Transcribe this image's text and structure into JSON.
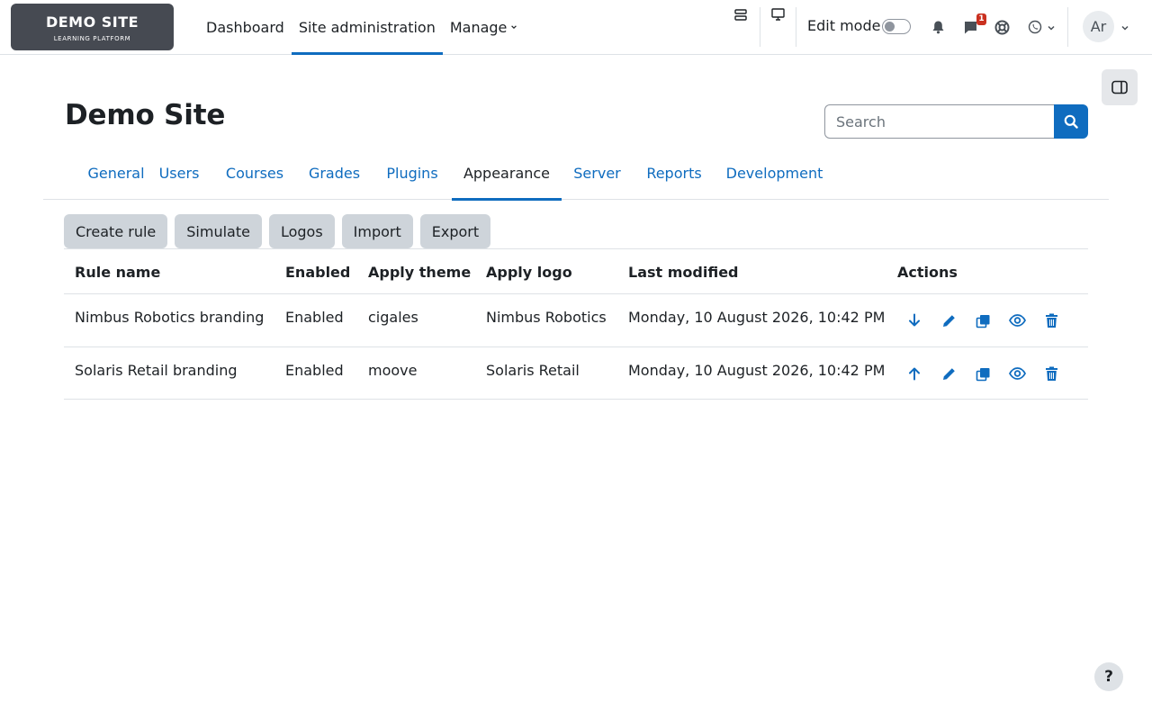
{
  "brand": {
    "title": "DEMO SITE",
    "subtitle": "LEARNING PLATFORM",
    "bg_color": "#464a52"
  },
  "primary_nav": {
    "items": [
      {
        "label": "Dashboard",
        "active": false
      },
      {
        "label": "Site administration",
        "active": true
      },
      {
        "label": "Manage",
        "active": false,
        "has_dropdown": true
      }
    ]
  },
  "user_nav": {
    "edit_mode_label": "Edit mode",
    "edit_mode_on": false,
    "messages_badge": "1",
    "avatar_initials": "Ar",
    "icons": [
      "list-icon",
      "monitor-icon",
      "bell-icon",
      "chat-icon",
      "lifebuoy-icon",
      "whatsapp-icon",
      "chevron-down-icon"
    ]
  },
  "page": {
    "title": "Demo Site",
    "search_placeholder": "Search"
  },
  "tabs": [
    {
      "label": "General",
      "active": false
    },
    {
      "label": "Users",
      "active": false
    },
    {
      "label": "Courses",
      "active": false
    },
    {
      "label": "Grades",
      "active": false
    },
    {
      "label": "Plugins",
      "active": false
    },
    {
      "label": "Appearance",
      "active": true
    },
    {
      "label": "Server",
      "active": false
    },
    {
      "label": "Reports",
      "active": false
    },
    {
      "label": "Development",
      "active": false
    }
  ],
  "action_buttons": [
    "Create rule",
    "Simulate",
    "Logos",
    "Import",
    "Export"
  ],
  "table": {
    "headers": [
      "Rule name",
      "Enabled",
      "Apply theme",
      "Apply logo",
      "Last modified",
      "Actions"
    ],
    "rows": [
      {
        "rule_name": "Nimbus Robotics branding",
        "enabled": "Enabled",
        "theme": "cigales",
        "logo": "Nimbus Robotics",
        "modified": "Monday, 10 August 2026, 10:42 PM",
        "move": "arrow-down-icon"
      },
      {
        "rule_name": "Solaris Retail branding",
        "enabled": "Enabled",
        "theme": "moove",
        "logo": "Solaris Retail",
        "modified": "Monday, 10 August 2026, 10:42 PM",
        "move": "arrow-up-icon"
      }
    ],
    "row_actions": [
      "edit-icon",
      "duplicate-icon",
      "view-icon",
      "delete-icon"
    ]
  },
  "help_label": "?",
  "colors": {
    "accent": "#0f6cbf",
    "badge": "#ca3120",
    "button_bg": "#ced4da",
    "text": "#1d2125"
  }
}
